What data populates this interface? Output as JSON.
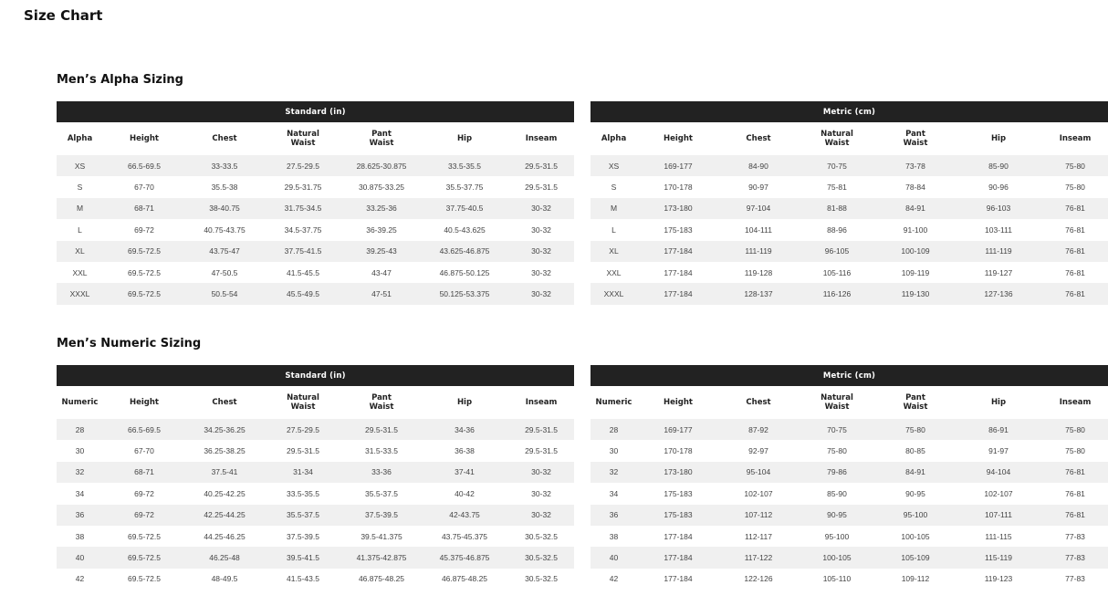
{
  "page_title": "Size Chart",
  "sections": [
    {
      "title": "Men’s Alpha Sizing",
      "tables": [
        {
          "header": "Standard (in)",
          "columns": [
            "Alpha",
            "Height",
            "Chest",
            "Natural\nWaist",
            "Pant\nWaist",
            "Hip",
            "Inseam"
          ],
          "rows": [
            [
              "XS",
              "66.5-69.5",
              "33-33.5",
              "27.5-29.5",
              "28.625-30.875",
              "33.5-35.5",
              "29.5-31.5"
            ],
            [
              "S",
              "67-70",
              "35.5-38",
              "29.5-31.75",
              "30.875-33.25",
              "35.5-37.75",
              "29.5-31.5"
            ],
            [
              "M",
              "68-71",
              "38-40.75",
              "31.75-34.5",
              "33.25-36",
              "37.75-40.5",
              "30-32"
            ],
            [
              "L",
              "69-72",
              "40.75-43.75",
              "34.5-37.75",
              "36-39.25",
              "40.5-43.625",
              "30-32"
            ],
            [
              "XL",
              "69.5-72.5",
              "43.75-47",
              "37.75-41.5",
              "39.25-43",
              "43.625-46.875",
              "30-32"
            ],
            [
              "XXL",
              "69.5-72.5",
              "47-50.5",
              "41.5-45.5",
              "43-47",
              "46.875-50.125",
              "30-32"
            ],
            [
              "XXXL",
              "69.5-72.5",
              "50.5-54",
              "45.5-49.5",
              "47-51",
              "50.125-53.375",
              "30-32"
            ]
          ]
        },
        {
          "header": "Metric (cm)",
          "columns": [
            "Alpha",
            "Height",
            "Chest",
            "Natural\nWaist",
            "Pant\nWaist",
            "Hip",
            "Inseam"
          ],
          "rows": [
            [
              "XS",
              "169-177",
              "84-90",
              "70-75",
              "73-78",
              "85-90",
              "75-80"
            ],
            [
              "S",
              "170-178",
              "90-97",
              "75-81",
              "78-84",
              "90-96",
              "75-80"
            ],
            [
              "M",
              "173-180",
              "97-104",
              "81-88",
              "84-91",
              "96-103",
              "76-81"
            ],
            [
              "L",
              "175-183",
              "104-111",
              "88-96",
              "91-100",
              "103-111",
              "76-81"
            ],
            [
              "XL",
              "177-184",
              "111-119",
              "96-105",
              "100-109",
              "111-119",
              "76-81"
            ],
            [
              "XXL",
              "177-184",
              "119-128",
              "105-116",
              "109-119",
              "119-127",
              "76-81"
            ],
            [
              "XXXL",
              "177-184",
              "128-137",
              "116-126",
              "119-130",
              "127-136",
              "76-81"
            ]
          ]
        }
      ]
    },
    {
      "title": "Men’s Numeric Sizing",
      "tables": [
        {
          "header": "Standard (in)",
          "columns": [
            "Numeric",
            "Height",
            "Chest",
            "Natural\nWaist",
            "Pant\nWaist",
            "Hip",
            "Inseam"
          ],
          "rows": [
            [
              "28",
              "66.5-69.5",
              "34.25-36.25",
              "27.5-29.5",
              "29.5-31.5",
              "34-36",
              "29.5-31.5"
            ],
            [
              "30",
              "67-70",
              "36.25-38.25",
              "29.5-31.5",
              "31.5-33.5",
              "36-38",
              "29.5-31.5"
            ],
            [
              "32",
              "68-71",
              "37.5-41",
              "31-34",
              "33-36",
              "37-41",
              "30-32"
            ],
            [
              "34",
              "69-72",
              "40.25-42.25",
              "33.5-35.5",
              "35.5-37.5",
              "40-42",
              "30-32"
            ],
            [
              "36",
              "69-72",
              "42.25-44.25",
              "35.5-37.5",
              "37.5-39.5",
              "42-43.75",
              "30-32"
            ],
            [
              "38",
              "69.5-72.5",
              "44.25-46.25",
              "37.5-39.5",
              "39.5-41.375",
              "43.75-45.375",
              "30.5-32.5"
            ],
            [
              "40",
              "69.5-72.5",
              "46.25-48",
              "39.5-41.5",
              "41.375-42.875",
              "45.375-46.875",
              "30.5-32.5"
            ],
            [
              "42",
              "69.5-72.5",
              "48-49.5",
              "41.5-43.5",
              "46.875-48.25",
              "46.875-48.25",
              "30.5-32.5"
            ]
          ]
        },
        {
          "header": "Metric (cm)",
          "columns": [
            "Numeric",
            "Height",
            "Chest",
            "Natural\nWaist",
            "Pant\nWaist",
            "Hip",
            "Inseam"
          ],
          "rows": [
            [
              "28",
              "169-177",
              "87-92",
              "70-75",
              "75-80",
              "86-91",
              "75-80"
            ],
            [
              "30",
              "170-178",
              "92-97",
              "75-80",
              "80-85",
              "91-97",
              "75-80"
            ],
            [
              "32",
              "173-180",
              "95-104",
              "79-86",
              "84-91",
              "94-104",
              "76-81"
            ],
            [
              "34",
              "175-183",
              "102-107",
              "85-90",
              "90-95",
              "102-107",
              "76-81"
            ],
            [
              "36",
              "175-183",
              "107-112",
              "90-95",
              "95-100",
              "107-111",
              "76-81"
            ],
            [
              "38",
              "177-184",
              "112-117",
              "95-100",
              "100-105",
              "111-115",
              "77-83"
            ],
            [
              "40",
              "177-184",
              "117-122",
              "100-105",
              "105-109",
              "115-119",
              "77-83"
            ],
            [
              "42",
              "177-184",
              "122-126",
              "105-110",
              "109-112",
              "119-123",
              "77-83"
            ]
          ]
        }
      ]
    }
  ]
}
